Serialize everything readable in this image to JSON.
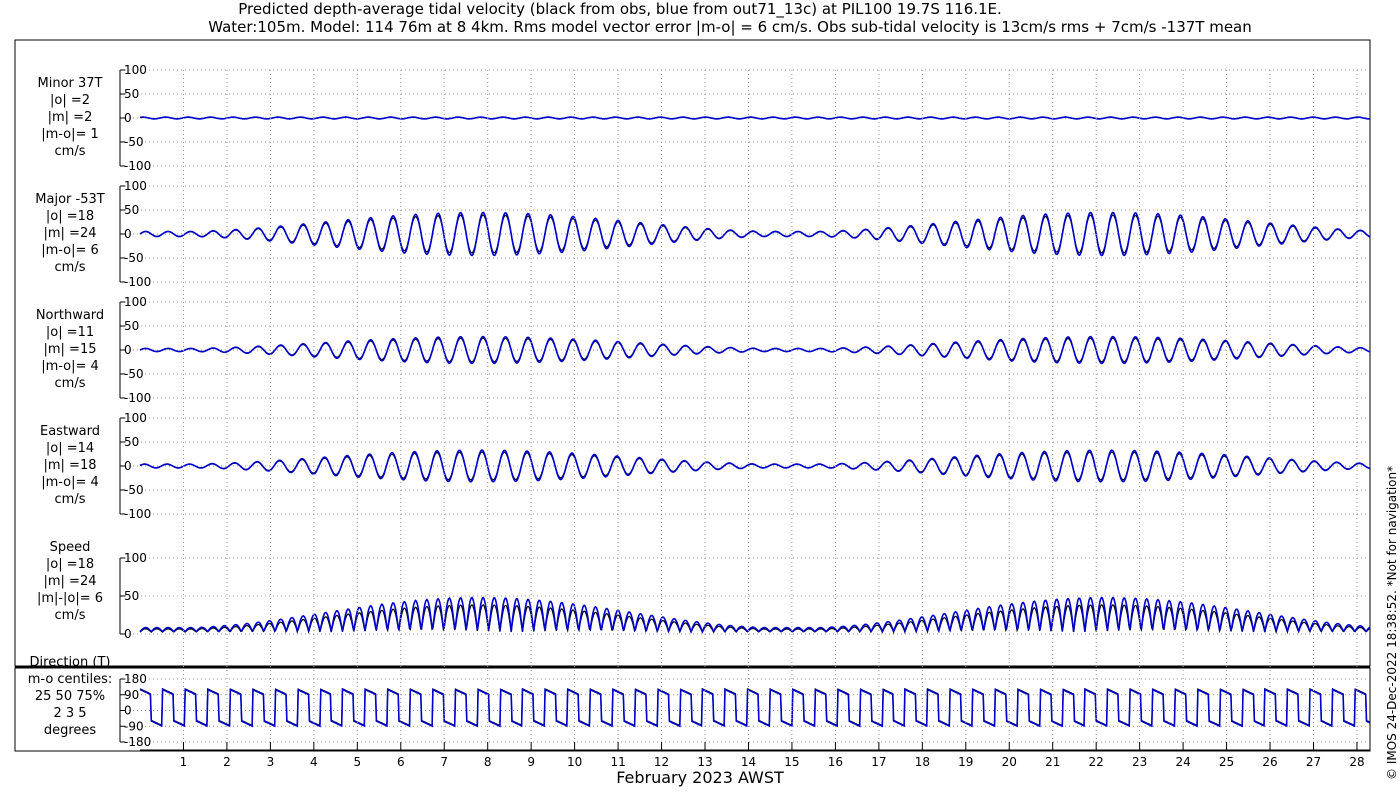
{
  "title_line1": "Predicted depth-average tidal velocity (black from obs, blue from out71_13c) at PIL100 19.7S 116.1E.",
  "title_line2": "Water:105m. Model: 114 76m at 8 4km. Rms model vector error |m-o| = 6 cm/s. Obs sub-tidal velocity is 13cm/s rms + 7cm/s -137T mean",
  "xlabel": "February 2023 AWST",
  "copyright": "© IMOS 24-Dec-2022 18:38:52.  *Not for navigation*",
  "colors": {
    "obs": "#000000",
    "model": "#0000cc",
    "grid": "#999999"
  },
  "chart_data": {
    "type": "line",
    "x_unit": "day of February 2023",
    "xlim": [
      0.0,
      28.3
    ],
    "x_ticks": [
      1,
      2,
      3,
      4,
      5,
      6,
      7,
      8,
      9,
      10,
      11,
      12,
      13,
      14,
      15,
      16,
      17,
      18,
      19,
      20,
      21,
      22,
      23,
      24,
      25,
      26,
      27,
      28
    ],
    "x_tick_labels": [
      "1",
      "2",
      "3",
      "4",
      "5",
      "6",
      "7",
      "8",
      "9",
      "10",
      "11",
      "12",
      "13",
      "14",
      "15",
      "16",
      "17",
      "18",
      "19",
      "20",
      "21",
      "22",
      "23",
      "24",
      "25",
      "26",
      "27",
      "28"
    ],
    "panels": [
      {
        "name": "minor",
        "label": "Minor 37T\n|o| =2\n|m| =2\n|m-o|= 1\ncm/s",
        "ylim": [
          -100,
          100
        ],
        "yticks": [
          100,
          50,
          0,
          -50,
          -100
        ],
        "ytick_labels": [
          "100",
          "50",
          "0",
          "-50",
          "-100"
        ],
        "amplitude": 2,
        "grid": true
      },
      {
        "name": "major",
        "label": "Major -53T\n|o| =18\n|m| =24\n|m-o|= 6\ncm/s",
        "ylim": [
          -100,
          100
        ],
        "yticks": [
          100,
          50,
          0,
          -50,
          -100
        ],
        "ytick_labels": [
          "100",
          "50",
          "0",
          "-50",
          "-100"
        ],
        "amplitude": 45,
        "grid": true
      },
      {
        "name": "northward",
        "label": "Northward\n|o| =11\n|m| =15\n|m-o|= 4\ncm/s",
        "ylim": [
          -100,
          100
        ],
        "yticks": [
          100,
          50,
          0,
          -50,
          -100
        ],
        "ytick_labels": [
          "100",
          "50",
          "0",
          "-50",
          "-100"
        ],
        "amplitude": 28,
        "grid": true
      },
      {
        "name": "eastward",
        "label": "Eastward\n|o| =14\n|m| =18\n|m-o|= 4\ncm/s",
        "ylim": [
          -100,
          100
        ],
        "yticks": [
          100,
          50,
          0,
          -50,
          -100
        ],
        "ytick_labels": [
          "100",
          "50",
          "0",
          "-50",
          "-100"
        ],
        "amplitude": 33,
        "grid": true
      },
      {
        "name": "speed",
        "label": "Speed\n|o| =18\n|m| =24\n|m|-|o|= 6\ncm/s",
        "ylim": [
          0,
          100
        ],
        "yticks": [
          100,
          50,
          0
        ],
        "ytick_labels": [
          "100",
          "50",
          "0"
        ],
        "amplitude": 45,
        "grid": true
      },
      {
        "name": "direction",
        "label": "Direction (T)\nm-o centiles:\n25  50  75%\n2   3   5\ndegrees",
        "ylim": [
          -180,
          180
        ],
        "yticks": [
          180,
          90,
          0,
          -90,
          -180
        ],
        "ytick_labels": [
          "180",
          "90",
          "0",
          "-90",
          "-180"
        ],
        "grid": true
      }
    ]
  }
}
